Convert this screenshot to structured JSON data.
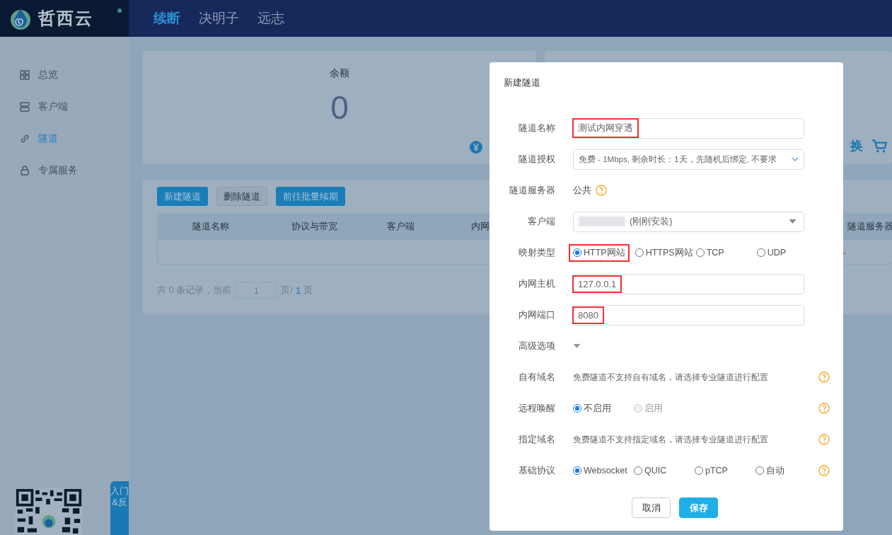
{
  "header": {
    "logo": "哲西云",
    "nav": [
      {
        "label": "续断",
        "selected": true
      },
      {
        "label": "决明子",
        "selected": false
      },
      {
        "label": "远志",
        "selected": false
      }
    ]
  },
  "sidebar": {
    "items": [
      {
        "label": "总览",
        "kind": "grid",
        "selected": false
      },
      {
        "label": "客户端",
        "kind": "server",
        "selected": false
      },
      {
        "label": "隧道",
        "kind": "link",
        "selected": true
      },
      {
        "label": "专属服务",
        "kind": "lock",
        "selected": false
      }
    ],
    "feedback_tab": "入门&反"
  },
  "balance_card": {
    "label": "余额",
    "value": "0"
  },
  "exchange": {
    "label": "换"
  },
  "tunnels": {
    "buttons": [
      {
        "label": "新建隧道",
        "kind": "primary"
      },
      {
        "label": "删除隧道",
        "kind": "default"
      },
      {
        "label": "前往批量续期",
        "kind": "primary"
      }
    ],
    "columns": [
      "隧道名称",
      "协议与带宽",
      "客户端",
      "内网",
      "隧道服务器"
    ],
    "empty_mark": "。",
    "pagination": {
      "summary": "共 0 条记录，当前",
      "page": "1",
      "sep": "页/",
      "total": "1",
      "unit": "页"
    }
  },
  "dialog": {
    "title": "新建隧道",
    "fields": [
      {
        "label": "隧道名称",
        "kind": "input",
        "value": "测试内网穿透",
        "highlighted": true
      },
      {
        "label": "隧道授权",
        "kind": "select",
        "value": "免费 - 1Mbps, 剩余时长：1天，先随机后绑定, 不要求"
      },
      {
        "label": "隧道服务器",
        "kind": "text",
        "value": "公共",
        "help": true
      },
      {
        "label": "客户端",
        "kind": "dropdown",
        "value": "(刚刚安装)",
        "redacted": true
      },
      {
        "label": "映射类型",
        "kind": "radios",
        "options": [
          {
            "label": "HTTP网站",
            "selected": true,
            "disabled": false,
            "highlighted": true
          },
          {
            "label": "HTTPS网站",
            "selected": false,
            "disabled": false,
            "highlighted": false
          },
          {
            "label": "TCP",
            "selected": false,
            "disabled": false,
            "highlighted": false
          },
          {
            "label": "UDP",
            "selected": false,
            "disabled": false,
            "highlighted": false
          }
        ]
      },
      {
        "label": "内网主机",
        "kind": "input",
        "value": "127.0.0.1",
        "highlighted": true
      },
      {
        "label": "内网端口",
        "kind": "input",
        "value": "8080",
        "highlighted": true
      },
      {
        "label": "高级选项",
        "kind": "toggle",
        "expanded": false
      },
      {
        "label": "自有域名",
        "kind": "note",
        "value": "免费隧道不支持自有域名，请选择专业隧道进行配置",
        "help": true
      },
      {
        "label": "远程唤醒",
        "kind": "radios",
        "help": true,
        "options": [
          {
            "label": "不启用",
            "selected": true,
            "disabled": false,
            "highlighted": false
          },
          {
            "label": "启用",
            "selected": false,
            "disabled": true,
            "highlighted": false
          }
        ]
      },
      {
        "label": "指定域名",
        "kind": "note",
        "value": "免费隧道不支持指定域名，请选择专业隧道进行配置",
        "help": true
      },
      {
        "label": "基础协议",
        "kind": "radios",
        "help": true,
        "options": [
          {
            "label": "Websocket",
            "selected": true,
            "disabled": false,
            "highlighted": false
          },
          {
            "label": "QUIC",
            "selected": false,
            "disabled": false,
            "highlighted": false
          },
          {
            "label": "pTCP",
            "selected": false,
            "disabled": false,
            "highlighted": false
          },
          {
            "label": "自动",
            "selected": false,
            "disabled": false,
            "highlighted": false
          }
        ]
      }
    ],
    "buttons": [
      {
        "label": "取消",
        "kind": "default"
      },
      {
        "label": "保存",
        "kind": "primary"
      }
    ]
  }
}
